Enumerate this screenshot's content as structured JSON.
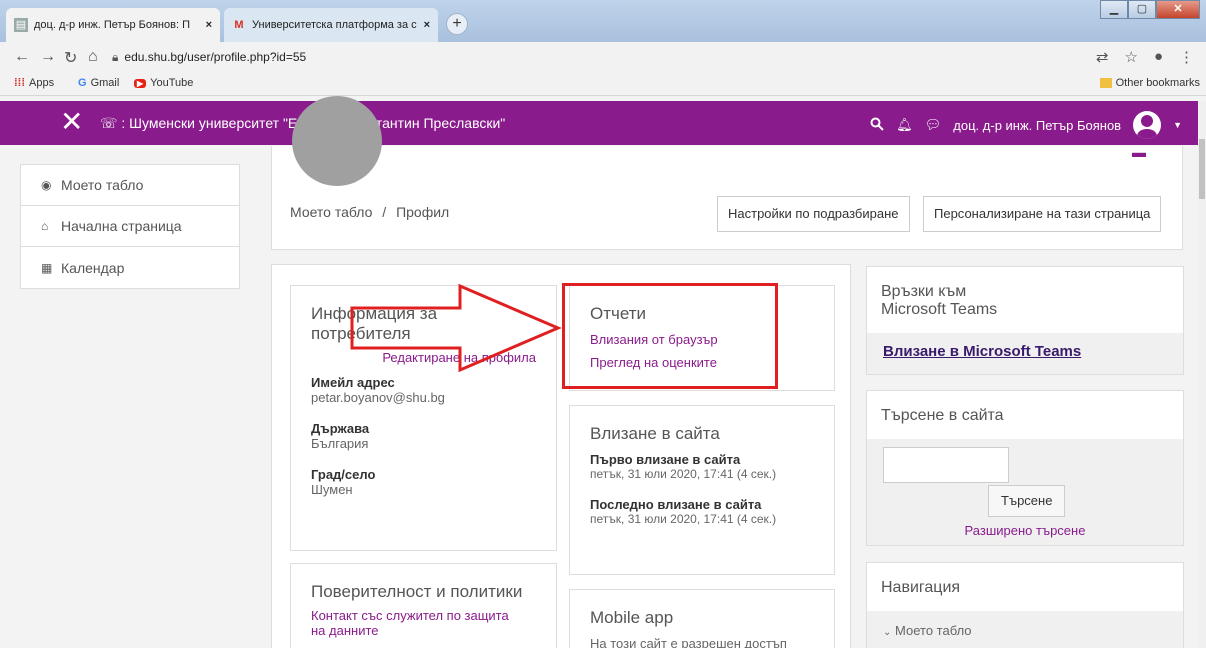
{
  "browser": {
    "tabs": [
      {
        "title": "доц. д-р инж. Петър Боянов: П",
        "close": "×"
      },
      {
        "title": "Университетска платформа за с",
        "close": "×"
      }
    ],
    "new_tab": "+",
    "url": "edu.shu.bg/user/profile.php?id=55",
    "bookmarks": [
      {
        "label": "Apps",
        "icon": "apps-grid-icon"
      },
      {
        "label": "Gmail",
        "icon": "google-g-icon"
      },
      {
        "label": "YouTube",
        "icon": "youtube-icon"
      }
    ],
    "other_bookmarks": "Other bookmarks"
  },
  "topnav": {
    "close": "✕",
    "phone_icon": "☏",
    "site_name": ": Шуменски университет \"Епископ Константин Преславски\"",
    "user_name": "доц. д-р инж. Петър Боянов",
    "brand_color": "#8a1b8c"
  },
  "sidebar": {
    "items": [
      {
        "label": "Моето табло",
        "icon": "dashboard-icon"
      },
      {
        "label": "Начална страница",
        "icon": "home-icon"
      },
      {
        "label": "Календар",
        "icon": "calendar-icon"
      }
    ]
  },
  "profile": {
    "breadcrumb_home": "Моето табло",
    "breadcrumb_sep": "/",
    "breadcrumb_current": "Профил",
    "btn_default": "Настройки по подразбиране",
    "btn_customize": "Персонализиране на тази страница"
  },
  "user_info": {
    "title_line1": "Информация за",
    "title_line2": "потребителя",
    "edit_link": "Редактиране на профила",
    "email_label": "Имейл адрес",
    "email": "petar.boyanov@shu.bg",
    "country_label": "Държава",
    "country": "България",
    "city_label": "Град/село",
    "city": "Шумен"
  },
  "reports": {
    "title": "Отчети",
    "link1": "Влизания от браузър",
    "link2": "Преглед на оценките"
  },
  "login": {
    "title": "Влизане в сайта",
    "first_label": "Първо влизане в сайта",
    "first_value": "петък, 31 юли 2020, 17:41  (4 сек.)",
    "last_label": "Последно влизане в сайта",
    "last_value": "петък, 31 юли 2020, 17:41  (4 сек.)"
  },
  "privacy": {
    "title": "Поверителност и политики",
    "link_line1": "Контакт със служител по защита",
    "link_line2": "на данните"
  },
  "mobile": {
    "title": "Mobile app",
    "text": "На този сайт е разрешен достъп"
  },
  "teams": {
    "title_line1": "Връзки към",
    "title_line2": "Microsoft Teams",
    "link": "Влизане в Microsoft Teams"
  },
  "search": {
    "title": "Търсене в сайта",
    "input_value": "",
    "button": "Търсене",
    "advanced": "Разширено търсене"
  },
  "navigation": {
    "title": "Навигация",
    "item": "Моето табло"
  },
  "annotation": {
    "arrow_color": "#e02020"
  }
}
